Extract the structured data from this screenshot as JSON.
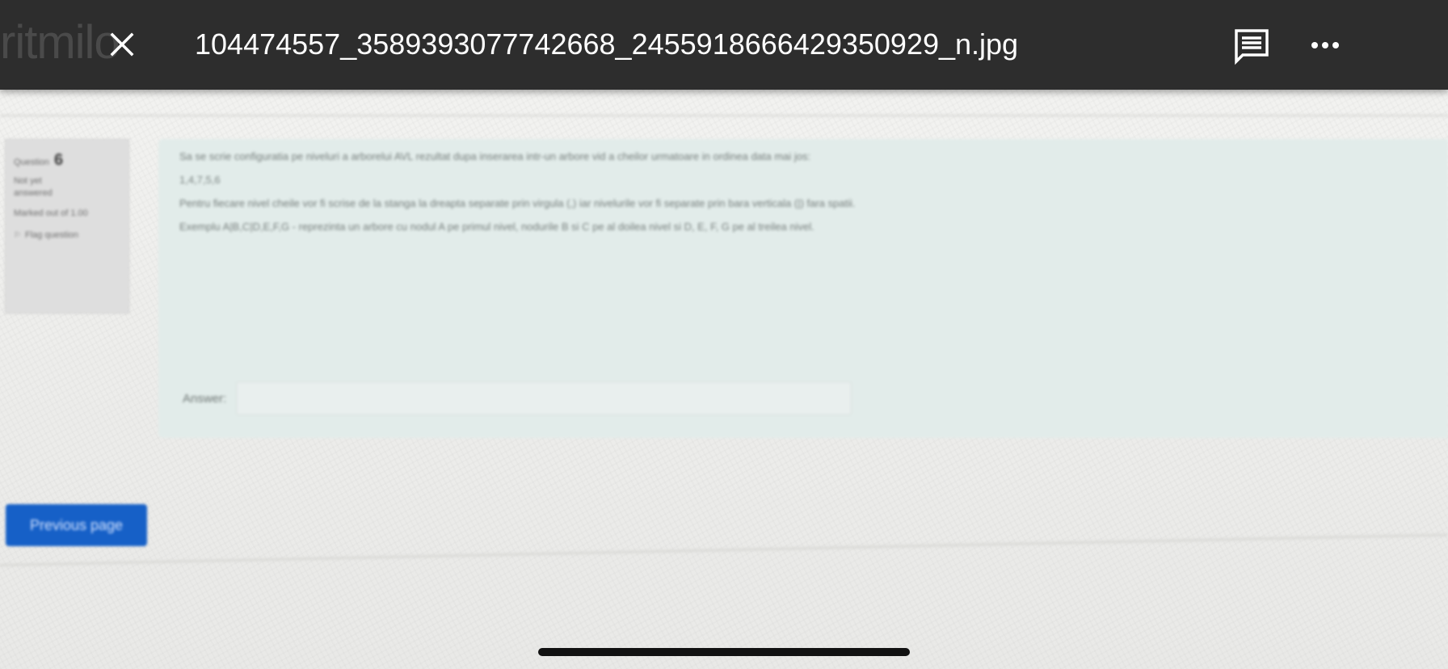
{
  "viewer": {
    "ghost_text": "ritmilo",
    "file_name": "104474557_3589393077742668_2455918666429350929_n.jpg",
    "icons": {
      "close": "close-icon",
      "comment": "comment-icon",
      "more": "more-options-icon"
    }
  },
  "question_info": {
    "label": "Question",
    "number": "6",
    "status": "Not yet answered",
    "marks": "Marked out of 1.00",
    "flag_label": "Flag question"
  },
  "question": {
    "line1": "Sa se scrie configuratia pe niveluri a arborelui AVL rezultat dupa inserarea intr-un arbore vid a cheilor urmatoare in ordinea data mai jos:",
    "sequence": "1,4,7,5,6",
    "line3": "Pentru fiecare nivel cheile vor fi scrise de la stanga la dreapta separate prin virgula (,) iar nivelurile vor fi separate prin bara verticala (|) fara spatii.",
    "line4": "Exemplu A|B,C|D,E,F,G - reprezinta un arbore cu nodul A pe primul nivel, nodurile B si C pe al doilea nivel si D, E, F, G pe al treilea nivel.",
    "answer_label": "Answer:",
    "answer_value": ""
  },
  "navigation": {
    "previous_label": "Previous page"
  },
  "colors": {
    "viewer_bar": "#2d2d2d",
    "question_box": "#e2ecea",
    "button_blue": "#1660c7"
  }
}
